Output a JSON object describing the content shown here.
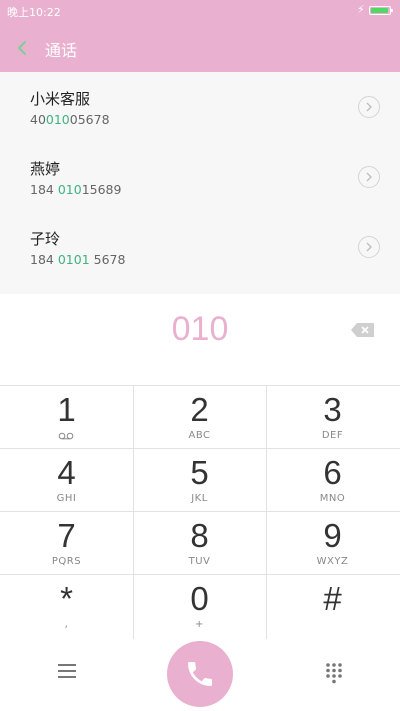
{
  "status_bar": {
    "time": "晚上10:22"
  },
  "header": {
    "title": "通话"
  },
  "contacts": [
    {
      "name": "小米客服",
      "number_pre": "40",
      "number_match": "010",
      "number_post": "05678"
    },
    {
      "name": "燕婷",
      "number_pre": "184 ",
      "number_match": "010",
      "number_post": "15689"
    },
    {
      "name": "子玲",
      "number_pre": "184 ",
      "number_match": "0101",
      "number_post": " 5678"
    }
  ],
  "dialed": {
    "digits": "010"
  },
  "keypad": [
    {
      "digit": "1",
      "letters": ""
    },
    {
      "digit": "2",
      "letters": "ABC"
    },
    {
      "digit": "3",
      "letters": "DEF"
    },
    {
      "digit": "4",
      "letters": "GHI"
    },
    {
      "digit": "5",
      "letters": "JKL"
    },
    {
      "digit": "6",
      "letters": "MNO"
    },
    {
      "digit": "7",
      "letters": "PQRS"
    },
    {
      "digit": "8",
      "letters": "TUV"
    },
    {
      "digit": "9",
      "letters": "WXYZ"
    },
    {
      "digit": "*",
      "letters": ","
    },
    {
      "digit": "0",
      "letters": "+"
    },
    {
      "digit": "#",
      "letters": ""
    }
  ],
  "icons": {
    "back": "chevron-left-icon",
    "backspace": "backspace-icon",
    "voicemail": "voicemail-icon",
    "menu": "menu-icon",
    "call": "phone-icon",
    "dialpad": "dialpad-grid-icon"
  },
  "colors": {
    "accent": "#e9b1cf",
    "match": "#3fb27f",
    "battery": "#4cd964"
  }
}
